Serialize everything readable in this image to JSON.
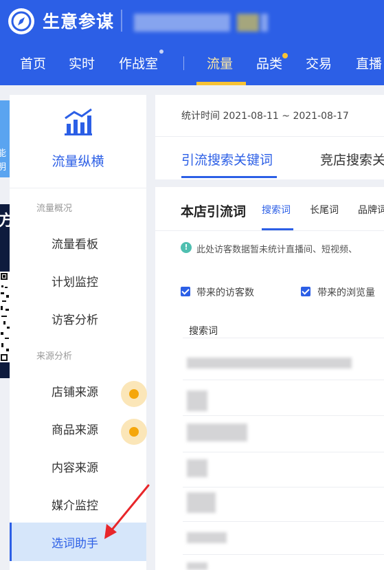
{
  "header": {
    "app_title": "生意参谋",
    "nav": [
      {
        "label": "首页"
      },
      {
        "label": "实时"
      },
      {
        "label": "作战室"
      },
      {
        "label": "流量"
      },
      {
        "label": "品类"
      },
      {
        "label": "交易"
      },
      {
        "label": "直播"
      }
    ],
    "active_nav": "流量",
    "accent_color": "#2c5fe6",
    "highlight_color": "#f7c234"
  },
  "left_widgets": {
    "promo_text_1": "能",
    "promo_text_2": "明",
    "qr_title": "方",
    "close_icon": "×"
  },
  "sidebar": {
    "title": "流量纵横",
    "groups": [
      {
        "label": "流量概况",
        "items": [
          {
            "label": "流量看板"
          },
          {
            "label": "计划监控"
          },
          {
            "label": "访客分析"
          }
        ]
      },
      {
        "label": "来源分析",
        "items": [
          {
            "label": "店铺来源"
          },
          {
            "label": "商品来源"
          },
          {
            "label": "内容来源"
          },
          {
            "label": "媒介监控"
          },
          {
            "label": "选词助手"
          }
        ]
      }
    ],
    "active_item": "选词助手"
  },
  "main": {
    "time_label": "统计时间 2021-08-11 ~ 2021-08-17",
    "tabs": [
      {
        "label": "引流搜索关键词"
      },
      {
        "label": "竞店搜索关"
      }
    ],
    "section_title": "本店引流词",
    "sub_tabs": [
      {
        "label": "搜索词"
      },
      {
        "label": "长尾词"
      },
      {
        "label": "品牌词"
      }
    ],
    "notice": "此处访客数据暂未统计直播间、短视频、",
    "checkboxes": [
      {
        "label": "带来的访客数",
        "checked": true
      },
      {
        "label": "带来的浏览量",
        "checked": true
      }
    ],
    "table": {
      "column_header": "搜索词"
    }
  }
}
